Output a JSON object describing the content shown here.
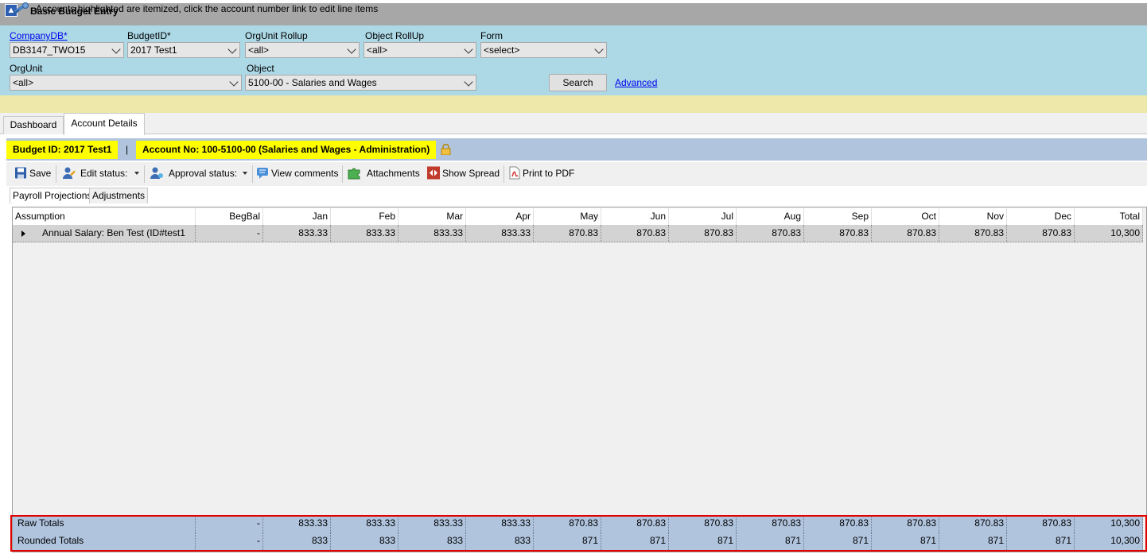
{
  "window": {
    "title": "Basic Budget Entry"
  },
  "filters": {
    "companydb": {
      "label": "CompanyDB*",
      "value": "DB3147_TWO15"
    },
    "budgetid": {
      "label": "BudgetID*",
      "value": "2017 Test1"
    },
    "orgunit_rollup": {
      "label": "OrgUnit Rollup",
      "value": "<all>"
    },
    "object_rollup": {
      "label": "Object RollUp",
      "value": "<all>"
    },
    "form": {
      "label": "Form",
      "value": "<select>"
    },
    "orgunit": {
      "label": "OrgUnit",
      "value": "<all>"
    },
    "object": {
      "label": "Object",
      "value": "5100-00 - Salaries and Wages"
    },
    "search_label": "Search",
    "advanced_label": "Advanced"
  },
  "info": {
    "text": "Accounts highlighted are itemized, click the account number link to edit line items"
  },
  "tabs": [
    {
      "label": "Dashboard"
    },
    {
      "label": "Account Details"
    }
  ],
  "header": {
    "budget": "Budget ID: 2017 Test1",
    "separator": "|",
    "account": "Account No: 100-5100-00 (Salaries and Wages - Administration)"
  },
  "toolbar": {
    "save": "Save",
    "edit_status": "Edit status:",
    "approval_status": "Approval status:",
    "view_comments": "View comments",
    "attachments": "Attachments",
    "show_spread": "Show Spread",
    "print_pdf": "Print to PDF"
  },
  "subtabs": [
    {
      "label": "Payroll Projections"
    },
    {
      "label": "Adjustments"
    }
  ],
  "grid": {
    "columns": [
      "Assumption",
      "BegBal",
      "Jan",
      "Feb",
      "Mar",
      "Apr",
      "May",
      "Jun",
      "Jul",
      "Aug",
      "Sep",
      "Oct",
      "Nov",
      "Dec",
      "Total"
    ],
    "rows": [
      {
        "label": "Annual Salary: Ben  Test (ID#test1",
        "values": [
          "-",
          "833.33",
          "833.33",
          "833.33",
          "833.33",
          "870.83",
          "870.83",
          "870.83",
          "870.83",
          "870.83",
          "870.83",
          "870.83",
          "870.83",
          "10,300"
        ]
      }
    ],
    "totals": [
      {
        "label": "Raw Totals",
        "values": [
          "-",
          "833.33",
          "833.33",
          "833.33",
          "833.33",
          "870.83",
          "870.83",
          "870.83",
          "870.83",
          "870.83",
          "870.83",
          "870.83",
          "870.83",
          "10,300"
        ]
      },
      {
        "label": "Rounded Totals",
        "values": [
          "-",
          "833",
          "833",
          "833",
          "833",
          "871",
          "871",
          "871",
          "871",
          "871",
          "871",
          "871",
          "871",
          "10,300"
        ]
      }
    ]
  },
  "colors": {
    "title_bar": "#a7a7a7",
    "filter_panel": "#add8e6",
    "info_bar": "#eee8aa",
    "highlight": "#ffff00",
    "totals_row": "#b0c4de",
    "annotation": "#e00000"
  }
}
